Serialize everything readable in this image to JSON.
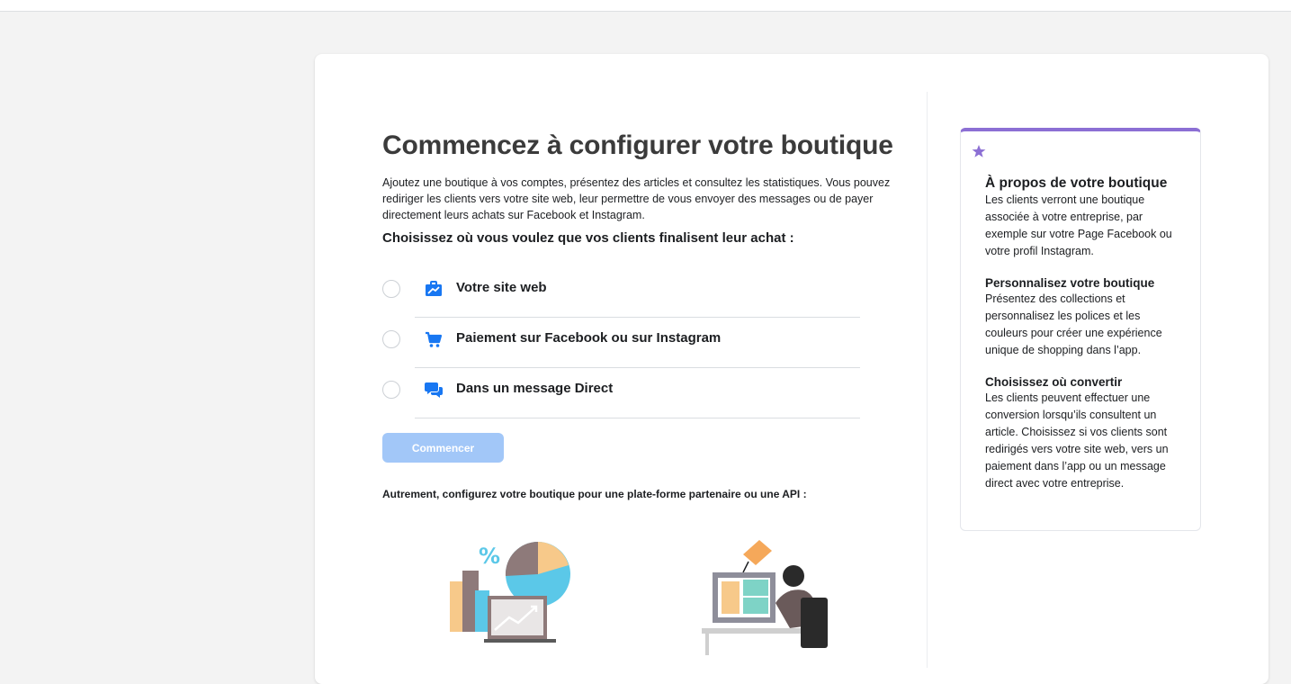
{
  "page": {
    "title": "Commencez à configurer votre boutique",
    "description": "Ajoutez une boutique à vos comptes, présentez des articles et consultez les statistiques. Vous pouvez rediriger les clients vers votre site web, leur permettre de vous envoyer des messages ou de payer directement leurs achats sur Facebook et Instagram.",
    "choose_heading": "Choisissez où vous voulez que vos clients finalisent leur achat :",
    "options": [
      {
        "label": "Votre site web",
        "icon": "briefcase-icon"
      },
      {
        "label": "Paiement sur Facebook ou sur Instagram",
        "icon": "cart-icon"
      },
      {
        "label": "Dans un message Direct",
        "icon": "chat-bubbles-icon"
      }
    ],
    "start_button": "Commencer",
    "alt_text": "Autrement, configurez votre boutique pour une plate-forme partenaire ou une API :"
  },
  "sidebar": {
    "icon": "star-icon",
    "sections": [
      {
        "heading": "À propos de votre boutique",
        "text": "Les clients verront une boutique associée à votre entreprise, par exemple sur votre Page Facebook ou votre profil Instagram."
      },
      {
        "heading": "Personnalisez votre boutique",
        "text": "Présentez des collections et personnalisez les polices et les couleurs pour créer une expérience unique de shopping dans l’app."
      },
      {
        "heading": "Choisissez où convertir",
        "text": "Les clients peuvent effectuer une conversion lorsqu’ils consultent un article. Choisissez si vos clients sont redirigés vers votre site web, vers un paiement dans l’app ou un message direct avec votre entreprise."
      }
    ]
  },
  "colors": {
    "accent_blue": "#1877f2",
    "button_disabled": "#a2c7f8",
    "sidebar_accent": "#8c6fd4"
  }
}
